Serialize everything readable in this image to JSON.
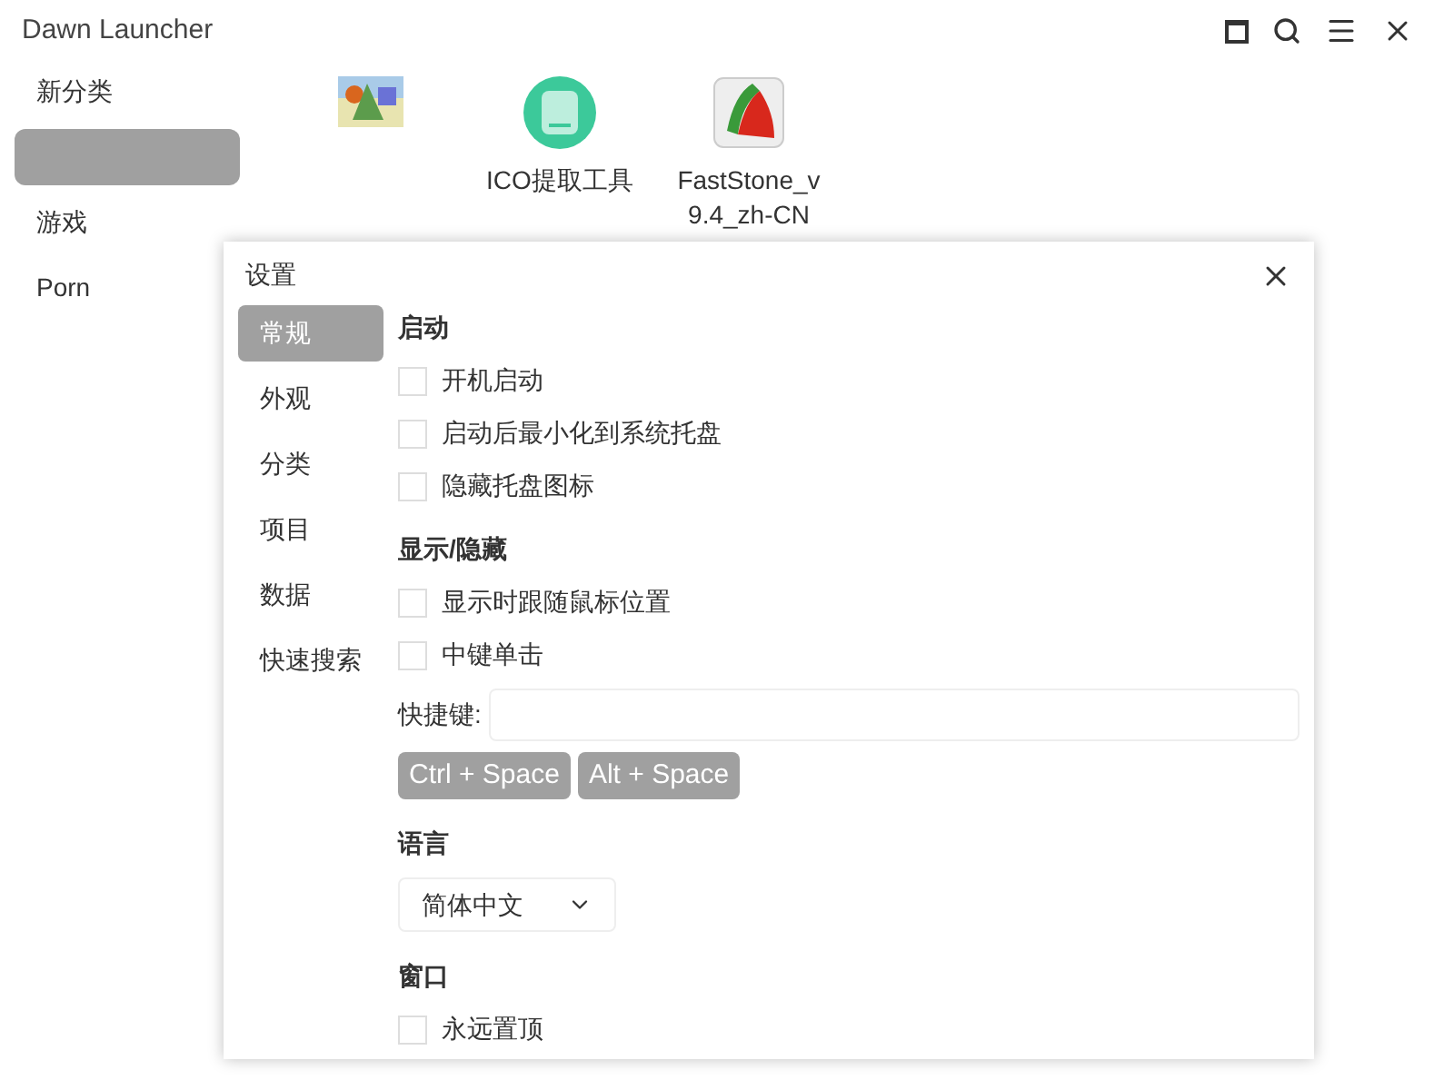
{
  "window": {
    "title": "Dawn Launcher"
  },
  "sidebar": {
    "items": [
      {
        "label": "新分类",
        "selected": false
      },
      {
        "selected": true
      },
      {
        "label": "游戏",
        "selected": false
      },
      {
        "label": "Porn",
        "selected": false
      }
    ]
  },
  "items": [
    {
      "kind": "picture"
    },
    {
      "kind": "disk",
      "label": "ICO提取工具"
    },
    {
      "kind": "fan",
      "label": "FastStone_v9.4_zh-CN"
    }
  ],
  "dialog": {
    "title": "设置",
    "nav": [
      {
        "label": "常规",
        "selected": true
      },
      {
        "label": "外观",
        "selected": false
      },
      {
        "label": "分类",
        "selected": false
      },
      {
        "label": "项目",
        "selected": false
      },
      {
        "label": "数据",
        "selected": false
      },
      {
        "label": "快速搜索",
        "selected": false
      }
    ],
    "sections": [
      {
        "title": "启动",
        "rows": [
          {
            "kind": "checkbox",
            "label": "开机启动",
            "checked": false
          },
          {
            "kind": "checkbox",
            "label": "启动后最小化到系统托盘",
            "checked": false
          },
          {
            "kind": "checkbox",
            "label": "隐藏托盘图标",
            "checked": false
          }
        ]
      },
      {
        "title": "显示/隐藏",
        "rows": [
          {
            "kind": "checkbox",
            "label": "显示时跟随鼠标位置",
            "checked": false
          },
          {
            "kind": "checkbox",
            "label": "中键单击",
            "checked": false
          },
          {
            "kind": "hotkey",
            "label": "快捷键:",
            "presets": [
              "Ctrl + Space",
              "Alt + Space"
            ]
          }
        ]
      },
      {
        "title": "语言",
        "rows": [
          {
            "kind": "select",
            "value": "简体中文"
          }
        ]
      },
      {
        "title": "窗口",
        "rows": [
          {
            "kind": "checkbox",
            "label": "永远置顶",
            "checked": false
          }
        ]
      }
    ]
  }
}
